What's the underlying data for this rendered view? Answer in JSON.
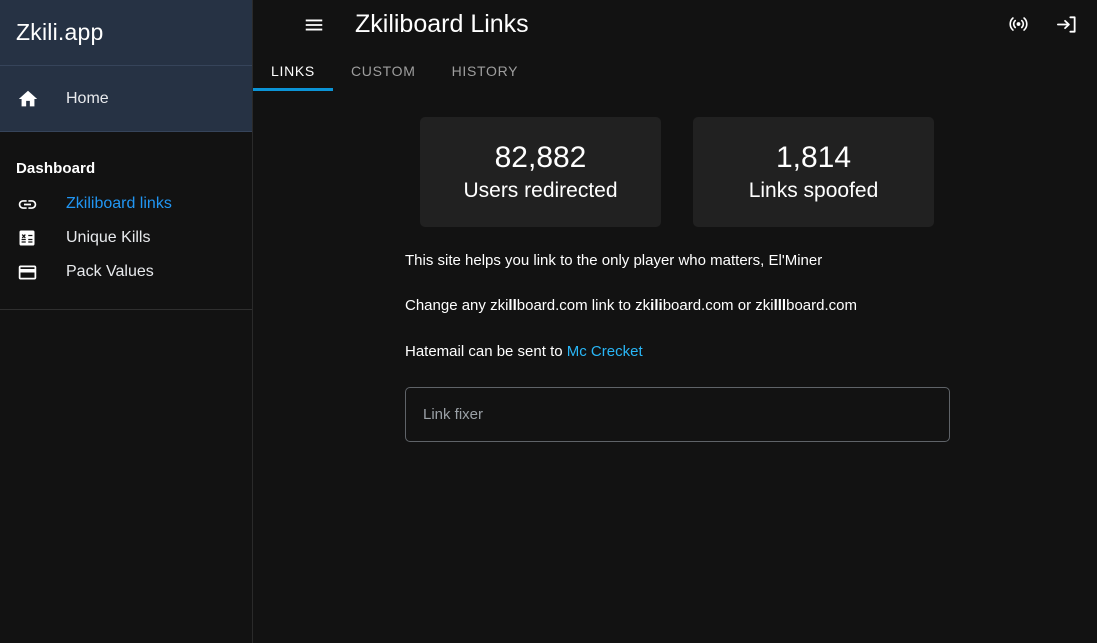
{
  "sidebar": {
    "brand": "Zkili.app",
    "home": {
      "label": "Home",
      "icon": "home-icon"
    },
    "section_label": "Dashboard",
    "items": [
      {
        "label": "Zkiliboard links",
        "icon": "link-icon",
        "active": true
      },
      {
        "label": "Unique Kills",
        "icon": "calculate-icon",
        "active": false
      },
      {
        "label": "Pack Values",
        "icon": "credit-card-icon",
        "active": false
      }
    ]
  },
  "topbar": {
    "menu_icon": "hamburger-menu-icon",
    "title": "Zkiliboard Links",
    "actions": [
      {
        "name": "broadcast-icon"
      },
      {
        "name": "login-icon"
      }
    ]
  },
  "tabs": [
    {
      "label": "LINKS",
      "active": true
    },
    {
      "label": "CUSTOM",
      "active": false
    },
    {
      "label": "HISTORY",
      "active": false
    }
  ],
  "stats": [
    {
      "value": "82,882",
      "label": "Users redirected"
    },
    {
      "value": "1,814",
      "label": "Links spoofed"
    }
  ],
  "paragraphs": {
    "p1": "This site helps you link to the only player who matters, El'Miner",
    "p2": {
      "lead": "Change any ",
      "d1_pre": "zki",
      "d1_bold": "ll",
      "d1_post": "board.com",
      "mid": " link to ",
      "d2_pre": "zk",
      "d2_bold": "ili",
      "d2_post": "board.com",
      "or": " or ",
      "d3_pre": "zki",
      "d3_bold": "lll",
      "d3_post": "board.com"
    },
    "p3": {
      "lead": "Hatemail can be sent to ",
      "link": "Mc Crecket"
    }
  },
  "link_fixer": {
    "placeholder": "Link fixer",
    "value": ""
  },
  "colors": {
    "accent_blue": "#0b94d6",
    "link_blue": "#29b6f6",
    "sidebar_highlight": "#263244",
    "card_bg": "#212121",
    "page_bg": "#121212"
  }
}
